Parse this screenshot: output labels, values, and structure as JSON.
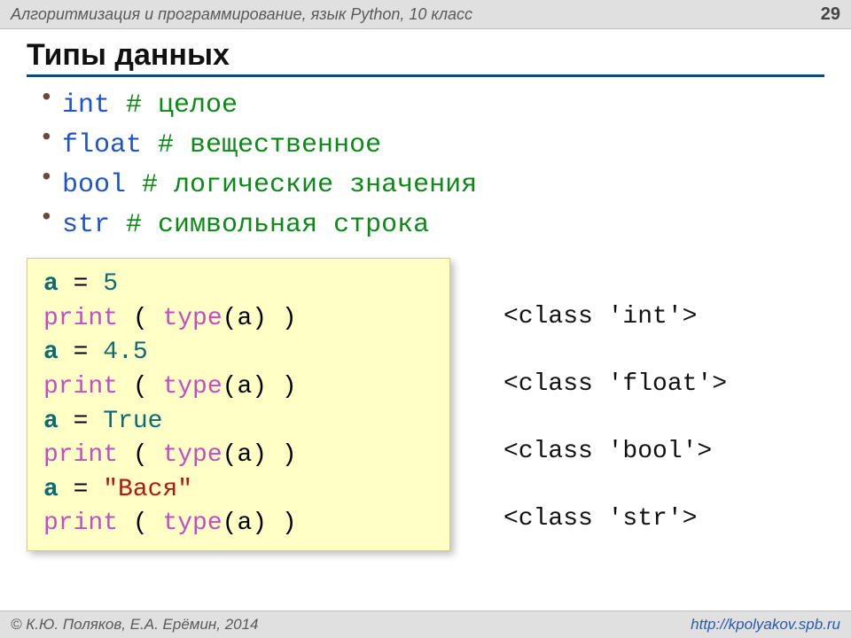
{
  "header": {
    "course": "Алгоритмизация и программирование, язык Python, 10 класс",
    "page": "29"
  },
  "title": "Типы данных",
  "types": [
    {
      "keyword": "int",
      "pad": "    ",
      "comment": "# целое"
    },
    {
      "keyword": "float",
      "pad": "  ",
      "comment": "# вещественное"
    },
    {
      "keyword": "bool",
      "pad": "     ",
      "comment": "# логические значения"
    },
    {
      "keyword": "str",
      "pad": "  ",
      "comment": "# символьная строка"
    }
  ],
  "code": {
    "l1_a": "a",
    "l1_eq": " = ",
    "l1_v": "5",
    "l2_p": "print",
    "l2_open": " ( ",
    "l2_t": "type",
    "l2_arg": "(a)",
    "l2_close": " )",
    "l3_a": "a",
    "l3_eq": " = ",
    "l3_v": "4.5",
    "l4_p": "print",
    "l4_open": " ( ",
    "l4_t": "type",
    "l4_arg": "(a)",
    "l4_close": " )",
    "l5_a": "a",
    "l5_eq": " = ",
    "l5_v": "True",
    "l6_p": "print",
    "l6_open": " ( ",
    "l6_t": "type",
    "l6_arg": "(a)",
    "l6_close": " )",
    "l7_a": "a",
    "l7_eq": " = ",
    "l7_v": "\"Вася\"",
    "l8_p": "print",
    "l8_open": " ( ",
    "l8_t": "type",
    "l8_arg": "(a)",
    "l8_close": " )"
  },
  "outputs": {
    "o1": "<class 'int'>",
    "o2": "<class 'float'>",
    "o3": "<class 'bool'>",
    "o4": "<class 'str'>"
  },
  "footer": {
    "authors": "© К.Ю. Поляков, Е.А. Ерёмин, 2014",
    "url": "http://kpolyakov.spb.ru"
  }
}
